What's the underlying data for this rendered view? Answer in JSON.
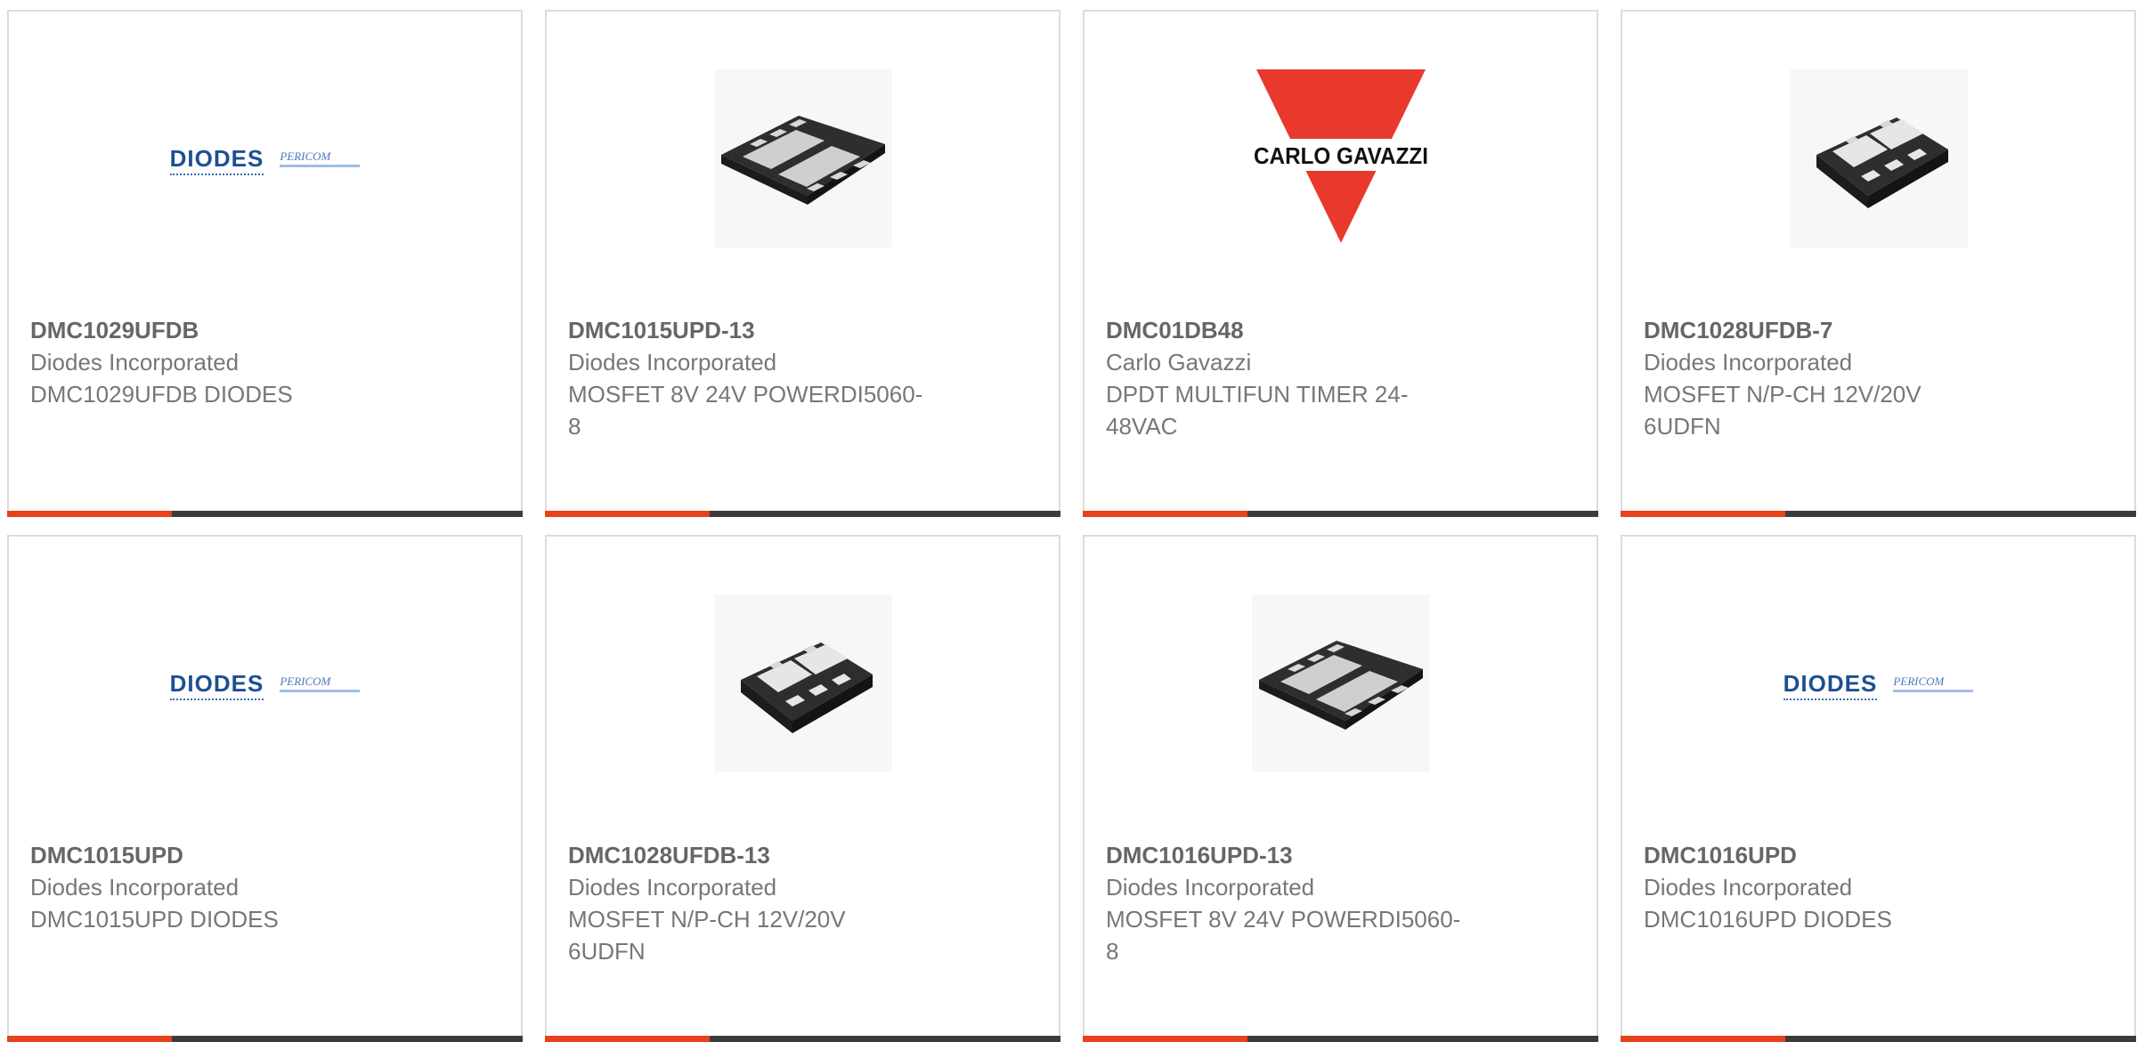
{
  "products": [
    {
      "part_number": "DMC1029UFDB",
      "manufacturer": "Diodes Incorporated",
      "description": "DMC1029UFDB DIODES",
      "image": "diodes-pericom-logo",
      "logo_text": {
        "brand": "DIODES",
        "sub_brand": "PERICOM"
      }
    },
    {
      "part_number": "DMC1015UPD-13",
      "manufacturer": "Diodes Incorporated",
      "description": "MOSFET 8V 24V POWERDI5060-8",
      "image": "powerdi5060-chip"
    },
    {
      "part_number": "DMC01DB48",
      "manufacturer": "Carlo Gavazzi",
      "description": "DPDT MULTIFUN TIMER 24-48VAC",
      "image": "carlo-gavazzi-logo",
      "logo_text": {
        "brand": "CARLO GAVAZZI"
      }
    },
    {
      "part_number": "DMC1028UFDB-7",
      "manufacturer": "Diodes Incorporated",
      "description": "MOSFET N/P-CH 12V/20V 6UDFN",
      "image": "udfn6-chip"
    },
    {
      "part_number": "DMC1015UPD",
      "manufacturer": "Diodes Incorporated",
      "description": "DMC1015UPD DIODES",
      "image": "diodes-pericom-logo",
      "logo_text": {
        "brand": "DIODES",
        "sub_brand": "PERICOM"
      }
    },
    {
      "part_number": "DMC1028UFDB-13",
      "manufacturer": "Diodes Incorporated",
      "description": "MOSFET N/P-CH 12V/20V 6UDFN",
      "image": "udfn6-chip"
    },
    {
      "part_number": "DMC1016UPD-13",
      "manufacturer": "Diodes Incorporated",
      "description": "MOSFET 8V 24V POWERDI5060-8",
      "image": "powerdi5060-chip"
    },
    {
      "part_number": "DMC1016UPD",
      "manufacturer": "Diodes Incorporated",
      "description": "DMC1016UPD DIODES",
      "image": "diodes-pericom-logo",
      "logo_text": {
        "brand": "DIODES",
        "sub_brand": "PERICOM"
      }
    }
  ],
  "colors": {
    "accent": "#e8411b",
    "bar_dark": "#3c3c3c",
    "diodes_blue": "#1d4f93",
    "carlo_gavazzi_red": "#e8392c"
  }
}
